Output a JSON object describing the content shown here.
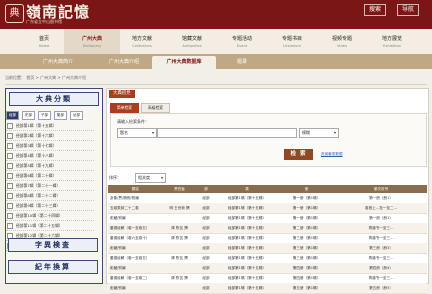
{
  "header": {
    "logo_glyph": "典",
    "title": "嶺南記憶",
    "subtitle": "广东省立中山图书馆",
    "search_btn": "搜索",
    "nav_btn": "导航"
  },
  "nav": [
    {
      "zh": "首页",
      "en": "Home"
    },
    {
      "zh": "广州大典",
      "en": "Dictionary",
      "active": true
    },
    {
      "zh": "地方文献",
      "en": "Collections"
    },
    {
      "zh": "馆藏文献",
      "en": "Antiquities"
    },
    {
      "zh": "专题活动",
      "en": "Event"
    },
    {
      "zh": "专题书目",
      "en": "Literature"
    },
    {
      "zh": "视频专题",
      "en": "Video"
    },
    {
      "zh": "地方展览",
      "en": "Exhibition"
    }
  ],
  "subnav": [
    {
      "label": "广州大典简介"
    },
    {
      "label": "广州大典介绍"
    },
    {
      "label": "广州大典数据库",
      "active": true
    },
    {
      "label": "题录"
    }
  ],
  "breadcrumb": "当前位置：  首页  >  广州大典  >  广州大典介绍",
  "sidebar": {
    "section1": "大典分類",
    "letters": [
      "经部",
      "史部",
      "子部",
      "集部",
      "丛部"
    ],
    "volumes": [
      "经部第1辑（第十五辑）",
      "经部第2辑（第十六辑）",
      "经部第3辑（第十七辑）",
      "经部第4辑（第十八辑）",
      "经部第5辑（第十九辑）",
      "经部第6辑（第二十辑）",
      "经部第7辑（第二十一辑）",
      "经部第8辑（第二十二辑）",
      "经部第9辑（第二十三辑）",
      "经部第10辑（第二十四辑）",
      "经部第11辑（第二十五辑）",
      "经部第12辑（第二十六辑）",
      "经部第13辑（第二十七辑）"
    ],
    "section2": "字異検査",
    "section3": "紀年換算"
  },
  "main": {
    "section_title": "大典初見",
    "tabs": [
      {
        "label": "简单检索",
        "active": true
      },
      {
        "label": "高级检索"
      }
    ],
    "search_prompt": "请输入检索条件：",
    "field_select": "题名",
    "keyword_value": "",
    "op_select": "模糊",
    "search_button": "检 索",
    "search_link": "查阅著录数据",
    "sort_label": "排序：",
    "sort_select": "相关度",
    "columns": [
      "题名",
      "责任者",
      "部",
      "类",
      "册",
      "册次页号"
    ],
    "rows": [
      [
        "卦象/贾/随例/别编",
        "",
        "经部",
        "经部第1辑（第十五辑）",
        "第一册（第1辑）",
        "第一册（册1）"
      ],
      [
        "玉组类辞二十二卷",
        "明  王世祯  撰",
        "经部",
        "经部第1辑（第十五辑）",
        "第一册（第1辑）",
        "卷首上...至一至二..."
      ],
      [
        "彭藏/别编",
        "",
        "经部",
        "经部第1辑（第十五辑）",
        "第一册（第1辑）",
        "第一册（册1）"
      ],
      [
        "董澳经解（卷一至卷五）",
        "清  陈瓦  撰",
        "经部",
        "经部第1辑（第十五辑）",
        "第二册（第1辑）",
        "再道书一至三..."
      ],
      [
        "董澳经解（卷六至卷十）",
        "清  陈瓦  撰",
        "经部",
        "经部第1辑（第十五辑）",
        "第三册（第1辑）",
        "再道书一至三..."
      ],
      [
        "彭藏/别编",
        "",
        "经部",
        "经部第1辑（第十五辑）",
        "第三册（第1辑）",
        "第三册（册3）"
      ],
      [
        "董澳经解（卷一至卷五）",
        "清  陈瓦  撰",
        "经部",
        "经部第1辑（第十五辑）",
        "第三册（第1辑）",
        "再道书一至三..."
      ],
      [
        "彭藏/别编",
        "",
        "经部",
        "经部第1辑（第十五辑）",
        "第四册（第1辑）",
        "第四册（册4）"
      ],
      [
        "董澳经解（卷一至卷二）",
        "清  陈瓦  撰",
        "经部",
        "经部第1辑（第十五辑）",
        "第四册（第1辑）",
        "再道书一至三..."
      ],
      [
        "彭藏/别编",
        "",
        "经部",
        "经部第1辑（第十五辑）",
        "第五册（第1辑）",
        "第五册（册5）"
      ]
    ]
  },
  "colors": {
    "brand": "#7b1616",
    "accent": "#a93d1f",
    "button": "#8e4a24",
    "sidebar_border": "#3c4a73"
  }
}
